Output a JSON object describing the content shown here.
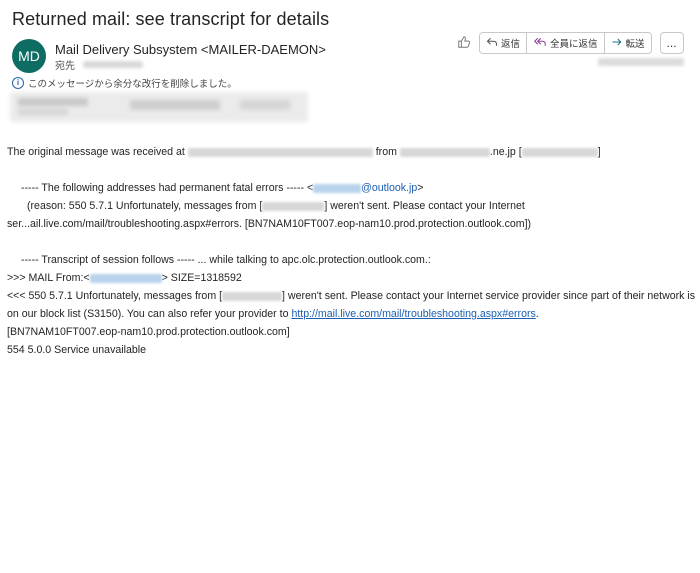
{
  "email": {
    "subject": "Returned mail: see transcript for details",
    "avatar_initials": "MD",
    "sender": "Mail Delivery Subsystem <MAILER-DAEMON>",
    "to_label": "宛先",
    "notice": "このメッセージから余分な改行を削除しました。"
  },
  "toolbar": {
    "reply_label": "返信",
    "reply_all_label": "全員に返信",
    "forward_label": "転送",
    "more_label": "..."
  },
  "body": {
    "l1_a": "The original message was received at",
    "l1_b": "from",
    "l1_c": ".ne.jp [",
    "l1_d": "]",
    "l2_a": "----- The following addresses had permanent fatal errors ----- <",
    "l2_email_domain": "@outlook.jp",
    "l2_b": ">",
    "l3_a": "(reason: 550 5.7.1 Unfortunately, messages from [",
    "l3_b": "] weren't sent. Please contact your Internet",
    "l4": "ser...ail.live.com/mail/troubleshooting.aspx#errors. [BN7NAM10FT007.eop-nam10.prod.protection.outlook.com])",
    "l5": "----- Transcript of session follows ----- ... while talking to apc.olc.protection.outlook.com.:",
    "l6_a": ">>> MAIL From:<",
    "l6_b": "> SIZE=1318592",
    "l7_a": "<<< 550 5.7.1 Unfortunately, messages from [",
    "l7_b": "] weren't sent. Please contact your Internet service provider since part of their network is on our block list (S3150). You can also refer your provider to",
    "l7_link": "http://mail.live.com/mail/troubleshooting.aspx#errors",
    "l7_c": ".",
    "l8": "[BN7NAM10FT007.eop-nam10.prod.protection.outlook.com]",
    "l9": "554 5.0.0 Service unavailable"
  }
}
